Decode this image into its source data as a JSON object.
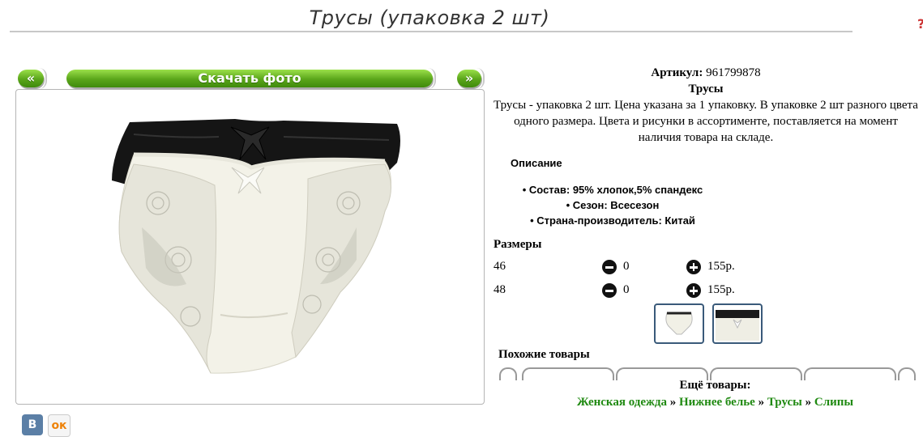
{
  "page": {
    "title": "Трусы (упаковка 2 шт)",
    "corner_mark": "?"
  },
  "gallery": {
    "prev_label": "«",
    "download_label": "Скачать фото",
    "next_label": "»"
  },
  "product": {
    "article_label": "Артикул:",
    "article_value": "961799878",
    "name": "Трусы",
    "description": "Трусы - упаковка 2 шт. Цена указана за 1 упаковку. В упаковке 2 шт разного цвета одного размера. Цвета и рисунки в ассортименте, поставляется на момент наличия товара на складе.",
    "description_heading": "Описание",
    "properties": [
      "Состав: 95% хлопок,5% спандекс",
      "Сезон: Всесезон",
      "Страна-производитель: Китай"
    ]
  },
  "sizes": {
    "heading": "Размеры",
    "rows": [
      {
        "size": "46",
        "qty": "0",
        "price": "155р."
      },
      {
        "size": "48",
        "qty": "0",
        "price": "155р."
      }
    ]
  },
  "similar": {
    "heading": "Похожие товары"
  },
  "more": {
    "heading": "Ещё товары:",
    "crumbs": [
      "Женская одежда",
      "Нижнее белье",
      "Трусы",
      "Слипы"
    ],
    "separator": "»"
  },
  "social": {
    "vk_label": "В",
    "ok_label": "ок"
  },
  "colors": {
    "accent_green": "#5aa51a",
    "link_green": "#208a12"
  }
}
